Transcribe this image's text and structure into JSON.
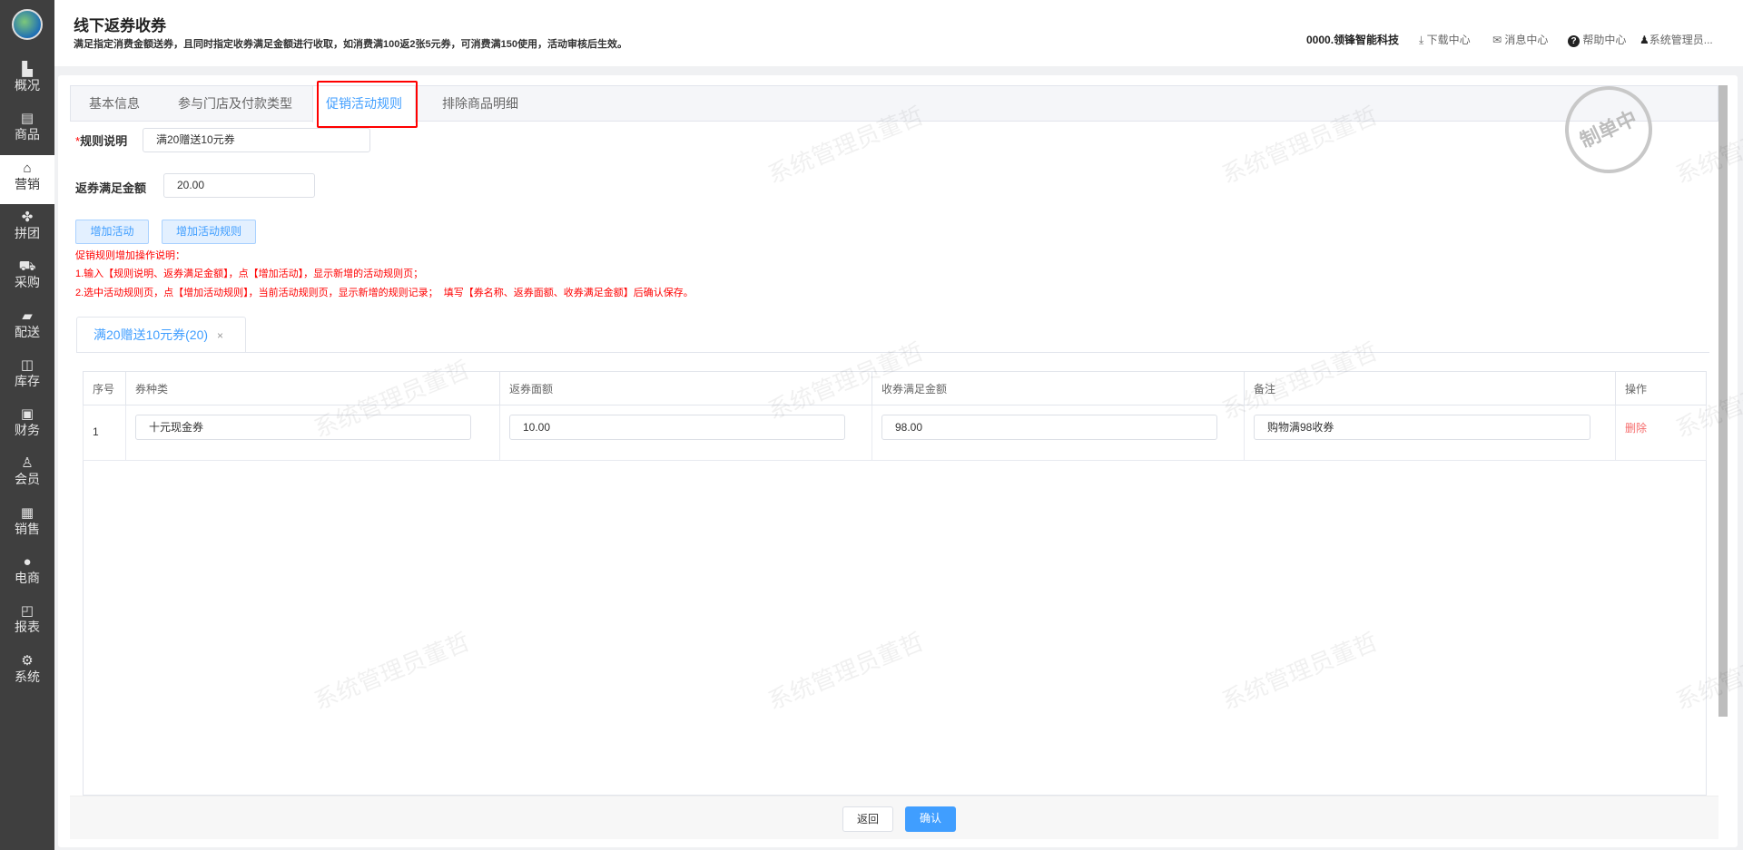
{
  "sidebar": {
    "items": [
      {
        "label": "概况",
        "icon": "building-icon",
        "glyph": "▙"
      },
      {
        "label": "商品",
        "icon": "document-icon",
        "glyph": "▤"
      },
      {
        "label": "营销",
        "icon": "tag-icon",
        "glyph": "⌂"
      },
      {
        "label": "拼团",
        "icon": "clover-icon",
        "glyph": "✤"
      },
      {
        "label": "采购",
        "icon": "cart-icon",
        "glyph": "⛟"
      },
      {
        "label": "配送",
        "icon": "truck-icon",
        "glyph": "▰"
      },
      {
        "label": "库存",
        "icon": "box-icon",
        "glyph": "◫"
      },
      {
        "label": "财务",
        "icon": "finance-icon",
        "glyph": "▣"
      },
      {
        "label": "会员",
        "icon": "user-icon",
        "glyph": "♙"
      },
      {
        "label": "销售",
        "icon": "register-icon",
        "glyph": "▦"
      },
      {
        "label": "电商",
        "icon": "person-icon",
        "glyph": "●"
      },
      {
        "label": "报表",
        "icon": "chart-board-icon",
        "glyph": "◰"
      },
      {
        "label": "系统",
        "icon": "gear-icon",
        "glyph": "⚙"
      }
    ],
    "active": "营销"
  },
  "header": {
    "title": "线下返券收券",
    "subtitle": "满足指定消费金额送券，且同时指定收券满足金额进行收取，如消费满100返2张5元券，可消费满150使用，活动审核后生效。",
    "company": "0000.领锋智能科技",
    "download": "下载中心",
    "messages": "消息中心",
    "help": "帮助中心",
    "user": "系统管理员..."
  },
  "tabs": [
    "基本信息",
    "参与门店及付款类型",
    "促销活动规则",
    "排除商品明细"
  ],
  "stamp": "制单中",
  "watermark": "系统管理员董哲",
  "form": {
    "rule_label": "规则说明",
    "rule_value": "满20赠送10元券",
    "amount_label": "返券满足金额",
    "amount_value": "20.00"
  },
  "buttons": {
    "add_activity": "增加活动",
    "add_rule": "增加活动规则",
    "back": "返回",
    "confirm": "确认"
  },
  "instructions": [
    "促销规则增加操作说明：",
    "1.输入【规则说明、返券满足金额】，点【增加活动】，显示新增的活动规则页；",
    "2.选中活动规则页，点【增加活动规则】，当前活动规则页，显示新增的规则记录；  填写【券名称、返券面额、收券满足金额】后确认保存。"
  ],
  "rule_tab": {
    "label": "满20赠送10元券(20)",
    "close": "×"
  },
  "table": {
    "headers": [
      "序号",
      "券种类",
      "返券面额",
      "收券满足金额",
      "备注",
      "操作"
    ],
    "rows": [
      {
        "index": "1",
        "type": "十元现金券",
        "face": "10.00",
        "min": "98.00",
        "note": "购物满98收券",
        "action": "删除"
      }
    ]
  }
}
